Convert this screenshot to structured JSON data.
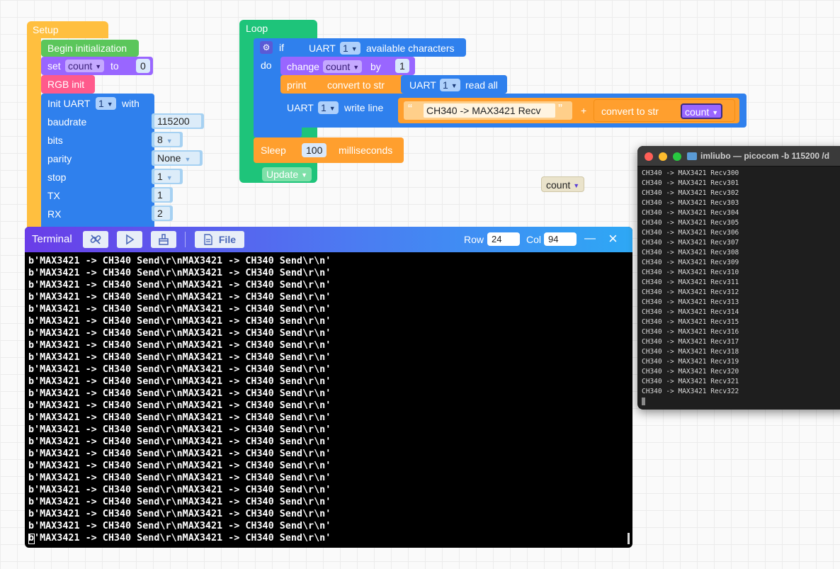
{
  "setup": {
    "header": "Setup",
    "begin_init": "Begin initialization",
    "set_label": "set",
    "set_var": "count",
    "to_label": "to",
    "set_value": "0",
    "rgb_init": "RGB init",
    "init_uart": "Init UART",
    "uart_num": "1",
    "with_label": "with",
    "params": [
      {
        "label": "baudrate",
        "value": "115200"
      },
      {
        "label": "bits",
        "value": "8"
      },
      {
        "label": "parity",
        "value": "None"
      },
      {
        "label": "stop",
        "value": "1"
      },
      {
        "label": "TX",
        "value": "1"
      },
      {
        "label": "RX",
        "value": "2"
      }
    ]
  },
  "loop": {
    "header": "Loop",
    "if_label": "if",
    "uart_label": "UART",
    "uart_num": "1",
    "available": "available characters",
    "do_label": "do",
    "change_label": "change",
    "change_var": "count",
    "by_label": "by",
    "by_value": "1",
    "print_label": "print",
    "convert_label": "convert to str",
    "read_all": "read all",
    "write_line": "write line",
    "open_quote": "“",
    "close_quote": "”",
    "string_value": "CH340 -> MAX3421 Recv",
    "plus": "+",
    "count_var": "count",
    "sleep_label": "Sleep",
    "sleep_value": "100",
    "ms_label": "milliseconds",
    "update_label": "Update"
  },
  "loose_var": "count",
  "terminal": {
    "title": "Terminal",
    "file_label": "File",
    "row_label": "Row",
    "row_value": "24",
    "col_label": "Col",
    "col_value": "94",
    "minimize": "—",
    "close": "×",
    "lines": [
      "b'MAX3421 -> CH340 Send\\r\\nMAX3421 -> CH340 Send\\r\\n'",
      "b'MAX3421 -> CH340 Send\\r\\nMAX3421 -> CH340 Send\\r\\n'",
      "b'MAX3421 -> CH340 Send\\r\\nMAX3421 -> CH340 Send\\r\\n'",
      "b'MAX3421 -> CH340 Send\\r\\nMAX3421 -> CH340 Send\\r\\n'",
      "b'MAX3421 -> CH340 Send\\r\\nMAX3421 -> CH340 Send\\r\\n'",
      "b'MAX3421 -> CH340 Send\\r\\nMAX3421 -> CH340 Send\\r\\n'",
      "b'MAX3421 -> CH340 Send\\r\\nMAX3421 -> CH340 Send\\r\\n'",
      "b'MAX3421 -> CH340 Send\\r\\nMAX3421 -> CH340 Send\\r\\n'",
      "b'MAX3421 -> CH340 Send\\r\\nMAX3421 -> CH340 Send\\r\\n'",
      "b'MAX3421 -> CH340 Send\\r\\nMAX3421 -> CH340 Send\\r\\n'",
      "b'MAX3421 -> CH340 Send\\r\\nMAX3421 -> CH340 Send\\r\\n'",
      "b'MAX3421 -> CH340 Send\\r\\nMAX3421 -> CH340 Send\\r\\n'",
      "b'MAX3421 -> CH340 Send\\r\\nMAX3421 -> CH340 Send\\r\\n'",
      "b'MAX3421 -> CH340 Send\\r\\nMAX3421 -> CH340 Send\\r\\n'",
      "b'MAX3421 -> CH340 Send\\r\\nMAX3421 -> CH340 Send\\r\\n'",
      "b'MAX3421 -> CH340 Send\\r\\nMAX3421 -> CH340 Send\\r\\n'",
      "b'MAX3421 -> CH340 Send\\r\\nMAX3421 -> CH340 Send\\r\\n'",
      "b'MAX3421 -> CH340 Send\\r\\nMAX3421 -> CH340 Send\\r\\n'",
      "b'MAX3421 -> CH340 Send\\r\\nMAX3421 -> CH340 Send\\r\\n'",
      "b'MAX3421 -> CH340 Send\\r\\nMAX3421 -> CH340 Send\\r\\n'",
      "b'MAX3421 -> CH340 Send\\r\\nMAX3421 -> CH340 Send\\r\\n'",
      "b'MAX3421 -> CH340 Send\\r\\nMAX3421 -> CH340 Send\\r\\n'",
      "b'MAX3421 -> CH340 Send\\r\\nMAX3421 -> CH340 Send\\r\\n'",
      "b'MAX3421 -> CH340 Send\\r\\nMAX3421 -> CH340 Send\\r\\n'"
    ]
  },
  "mac_terminal": {
    "title": "imliubo — picocom -b 115200 /d",
    "lines": [
      "CH340 -> MAX3421 Recv300",
      "CH340 -> MAX3421 Recv301",
      "CH340 -> MAX3421 Recv302",
      "CH340 -> MAX3421 Recv303",
      "CH340 -> MAX3421 Recv304",
      "CH340 -> MAX3421 Recv305",
      "CH340 -> MAX3421 Recv306",
      "CH340 -> MAX3421 Recv307",
      "CH340 -> MAX3421 Recv308",
      "CH340 -> MAX3421 Recv309",
      "CH340 -> MAX3421 Recv310",
      "CH340 -> MAX3421 Recv311",
      "CH340 -> MAX3421 Recv312",
      "CH340 -> MAX3421 Recv313",
      "CH340 -> MAX3421 Recv314",
      "CH340 -> MAX3421 Recv315",
      "CH340 -> MAX3421 Recv316",
      "CH340 -> MAX3421 Recv317",
      "CH340 -> MAX3421 Recv318",
      "CH340 -> MAX3421 Recv319",
      "CH340 -> MAX3421 Recv320",
      "CH340 -> MAX3421 Recv321",
      "CH340 -> MAX3421 Recv322"
    ]
  },
  "colors": {
    "setup_orange": "#ffbf3f",
    "loop_green": "#1ec47a",
    "init_green": "#5bc65b",
    "variable_purple": "#9966ff",
    "rgb_pink": "#ff5a8c",
    "uart_blue": "#2f80ed",
    "text_orange": "#ff9f2e"
  }
}
